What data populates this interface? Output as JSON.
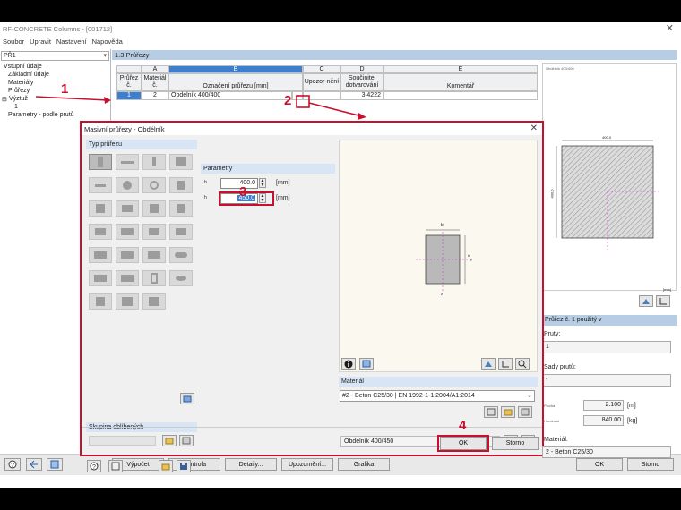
{
  "app": {
    "title": "RF-CONCRETE Columns - [001712]",
    "menu": [
      "Soubor",
      "Upravit",
      "Nastavení",
      "Nápověda"
    ]
  },
  "left_panel": {
    "case": "PŘ1",
    "tree": {
      "root": "Vstupní údaje",
      "items": [
        "Základní údaje",
        "Materiály",
        "Průřezy"
      ],
      "reinforcement": "Výztuž",
      "reinforcement_item": "1",
      "params": "Parametry - podle prutů"
    }
  },
  "main": {
    "header": "1.3 Průřezy",
    "table": {
      "col_letters": [
        "A",
        "B",
        "C",
        "D",
        "E"
      ],
      "headers": {
        "prurez": "Průřez č.",
        "material": "Materiál č.",
        "oznaceni": "Označení průřezu [mm]",
        "upozorneni": "Upozor-nění",
        "soucinitel": "Součinitel dotvarování",
        "komentar": "Komentář"
      },
      "row": {
        "no": "1",
        "material": "2",
        "designation": "Obdélník 400/400",
        "creep": "3.4222"
      }
    }
  },
  "right_panel": {
    "preview_caption": "Obdélník 400/400",
    "dim_width": "400.0",
    "dim_height": "400.0",
    "units_note": "[mm]",
    "used_in": "Průřez č. 1 použitý v",
    "pruty_label": "Pruty:",
    "pruty_value": "1",
    "sady_label": "Sady prutů:",
    "sady_value": "-",
    "area_label": "Plocha",
    "area_value": "2.100",
    "area_unit": "[m]",
    "weight_label": "Hmotnost",
    "weight_value": "840.00",
    "weight_unit": "[kg]",
    "material_label": "Materiál:",
    "material_value": "2 - Beton C25/30"
  },
  "bottom": {
    "buttons": [
      "Výpočet",
      "Kontrola",
      "Detaily...",
      "Upozornění...",
      "Grafika"
    ],
    "ok": "OK",
    "cancel": "Storno"
  },
  "dialog": {
    "title": "Masivní průřezy - Obdélník",
    "section_type": "Typ průřezu",
    "parameters": "Parametry",
    "b_label": "b",
    "b_value": "400.0",
    "h_label": "h",
    "h_value": "450.0",
    "unit": "[mm]",
    "favorites": "Skupina oblíbených",
    "material_group": "Materiál",
    "material": "#2 - Beton C25/30 | EN 1992-1-1:2004/A1:2014",
    "section_name": "Obdélník 400/450",
    "ok": "OK",
    "cancel": "Storno",
    "sketch_label_b": "b",
    "sketch_label_y": "y",
    "sketch_label_z": "z",
    "sketch_label_h": "h"
  },
  "annotations": [
    "1",
    "2",
    "3",
    "4"
  ],
  "colors": {
    "accent_red": "#c8102e",
    "selection_blue": "#3c7fce",
    "header_blue": "#b7cde4"
  }
}
